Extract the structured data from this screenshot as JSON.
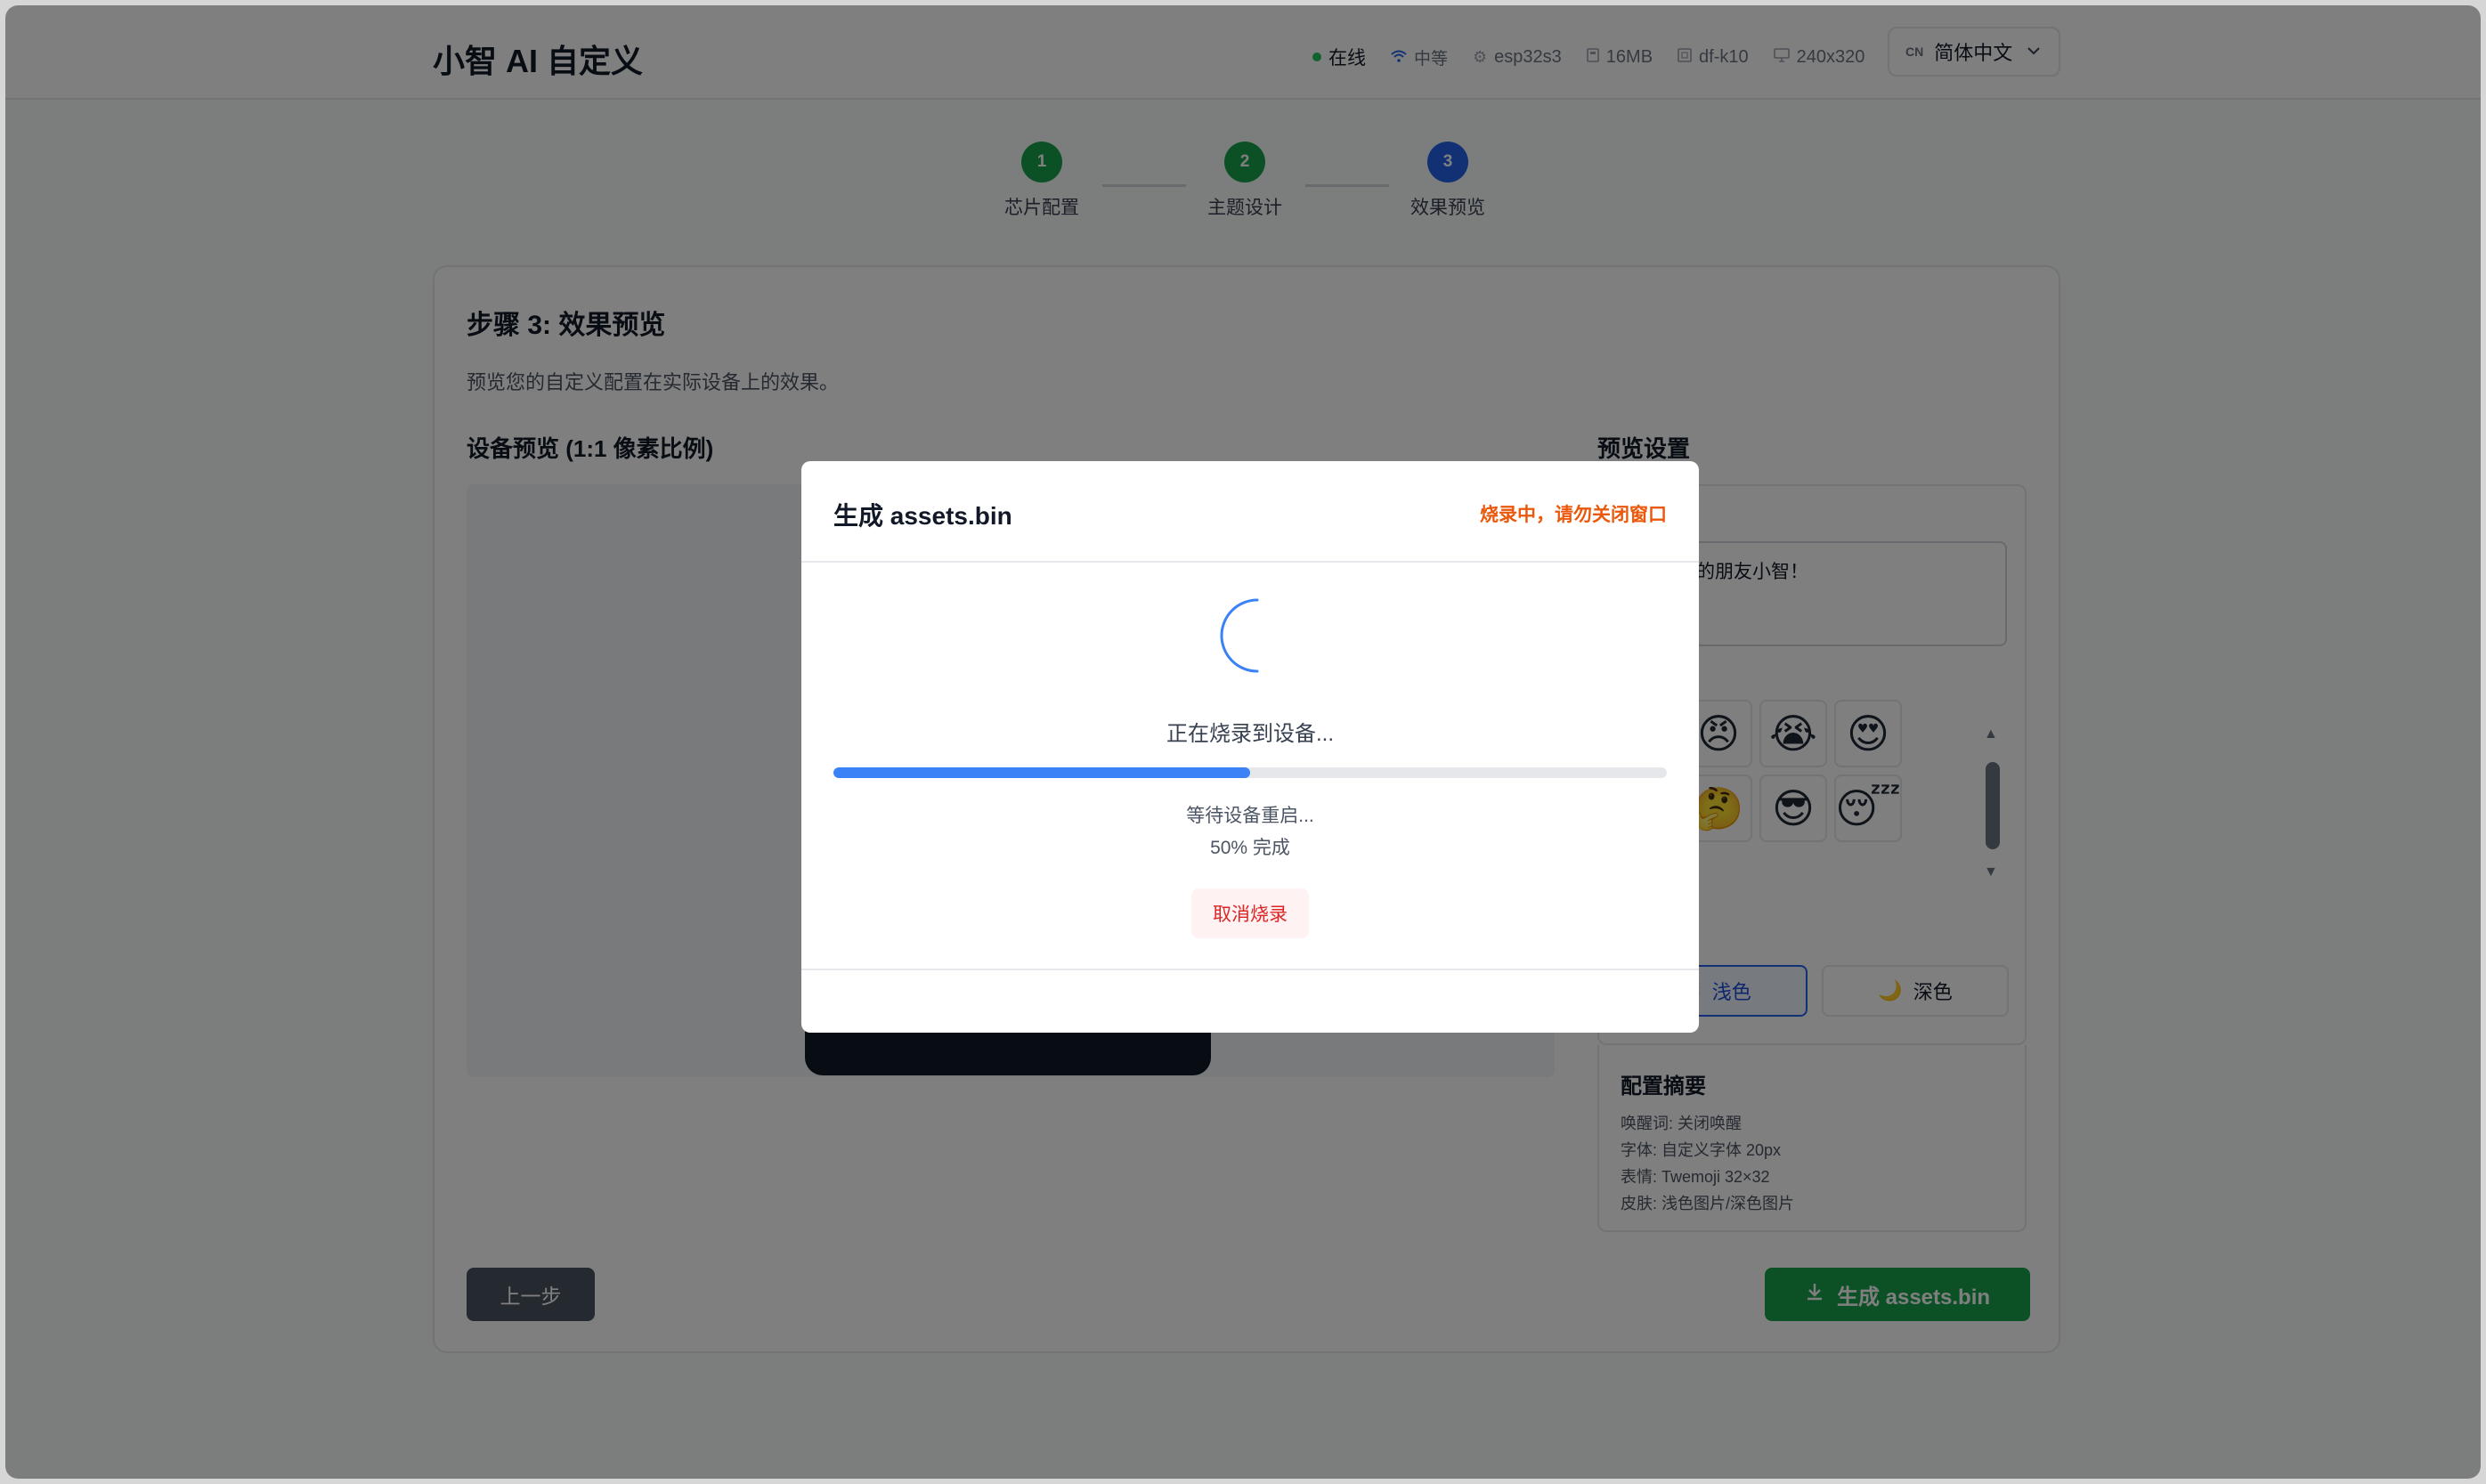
{
  "header": {
    "title": "小智 AI 自定义",
    "status_online": "在线",
    "signal": "中等",
    "chip": "esp32s3",
    "flash": "16MB",
    "board": "df-k10",
    "resolution": "240x320",
    "language_flag": "CN",
    "language": "简体中文"
  },
  "stepper": {
    "steps": [
      {
        "number": "1",
        "label": "芯片配置",
        "state": "done"
      },
      {
        "number": "2",
        "label": "主题设计",
        "state": "done"
      },
      {
        "number": "3",
        "label": "效果预览",
        "state": "active"
      }
    ]
  },
  "main": {
    "title": "步骤 3: 效果预览",
    "description": "预览您的自定义配置在实际设备上的效果。",
    "preview_title": "设备预览 (1:1 像素比例)",
    "settings_title": "预览设置",
    "wake_text": "我是你的朋友小智！",
    "emojis": [
      "😠",
      "😭",
      "😍",
      "🤔",
      "😎",
      "😴"
    ],
    "theme_light": "浅色",
    "theme_dark": "深色",
    "summary": {
      "title": "配置摘要",
      "wake_word": "唤醒词: 关闭唤醒",
      "font": "字体: 自定义字体 20px",
      "emoji": "表情: Twemoji 32×32",
      "skin": "皮肤: 浅色图片/深色图片"
    },
    "prev_button": "上一步",
    "generate_button": "生成 assets.bin"
  },
  "modal": {
    "title": "生成 assets.bin",
    "warning": "烧录中，请勿关闭窗口",
    "status": "正在烧录到设备...",
    "progress": 0.5,
    "substatus": "等待设备重启...",
    "percent_text": "50% 完成",
    "cancel_button": "取消烧录"
  },
  "colors": {
    "accent": "#3b82f6",
    "success": "#16a34a",
    "warning": "#ea580c",
    "danger": "#dc2626"
  }
}
